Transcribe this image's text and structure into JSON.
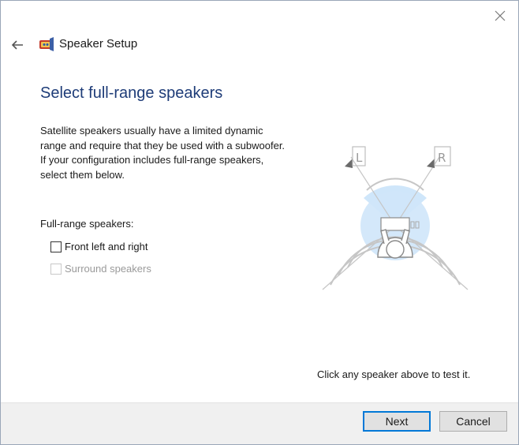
{
  "window": {
    "title": "Speaker Setup",
    "close_icon": "close-icon",
    "back_icon": "back-arrow-icon",
    "app_icon": "speaker-setup-icon"
  },
  "page": {
    "heading": "Select full-range speakers",
    "description_lines": [
      "Satellite speakers usually have a limited dynamic",
      "range and require that they be used with a subwoofer.",
      " If your configuration includes full-range speakers,",
      "select them below."
    ]
  },
  "speakers": {
    "group_label": "Full-range speakers:",
    "options": [
      {
        "label": "Front left and right",
        "checked": false,
        "enabled": true
      },
      {
        "label": "Surround speakers",
        "checked": false,
        "enabled": false
      }
    ]
  },
  "diagram": {
    "left_label": "L",
    "right_label": "R",
    "hint": "Click any speaker above to test it."
  },
  "footer": {
    "next_label": "Next",
    "cancel_label": "Cancel"
  },
  "colors": {
    "heading": "#1e3c78",
    "accent": "#0078d7",
    "sound_field": "#cfe6fa",
    "footer_bg": "#f0f0f0"
  }
}
